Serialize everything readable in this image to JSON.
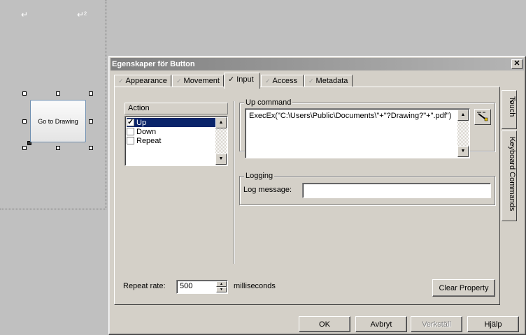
{
  "canvas": {
    "button_label": "Go to Drawing",
    "corner_mark_1": "↵",
    "corner_mark_2": "↵²"
  },
  "dialog": {
    "title": "Egenskaper för Button",
    "close_glyph": "✕",
    "tabs": [
      {
        "label": "Appearance",
        "active": false
      },
      {
        "label": "Movement",
        "active": false
      },
      {
        "label": "Input",
        "active": true
      },
      {
        "label": "Access",
        "active": false
      },
      {
        "label": "Metadata",
        "active": false
      }
    ],
    "side_tabs": [
      {
        "label": "Touch",
        "active": true
      },
      {
        "label": "Keyboard Commands",
        "active": false
      }
    ],
    "action": {
      "header": "Action",
      "items": [
        {
          "label": "Up",
          "checked": true,
          "selected": true
        },
        {
          "label": "Down",
          "checked": false,
          "selected": false
        },
        {
          "label": "Repeat",
          "checked": false,
          "selected": false
        }
      ]
    },
    "up_command": {
      "label": "Up command",
      "value": "ExecEx(\"C:\\Users\\Public\\Documents\\\"+\"?Drawing?\"+\".pdf\")",
      "wand_icon": "magic-wand-icon"
    },
    "logging": {
      "label": "Logging",
      "message_label": "Log message:",
      "message_value": ""
    },
    "repeat_rate": {
      "label": "Repeat rate:",
      "value": "500",
      "unit": "milliseconds"
    },
    "clear_property_label": "Clear Property",
    "footer": {
      "ok": "OK",
      "cancel": "Avbryt",
      "apply": "Verkställ",
      "help": "Hjälp"
    }
  }
}
